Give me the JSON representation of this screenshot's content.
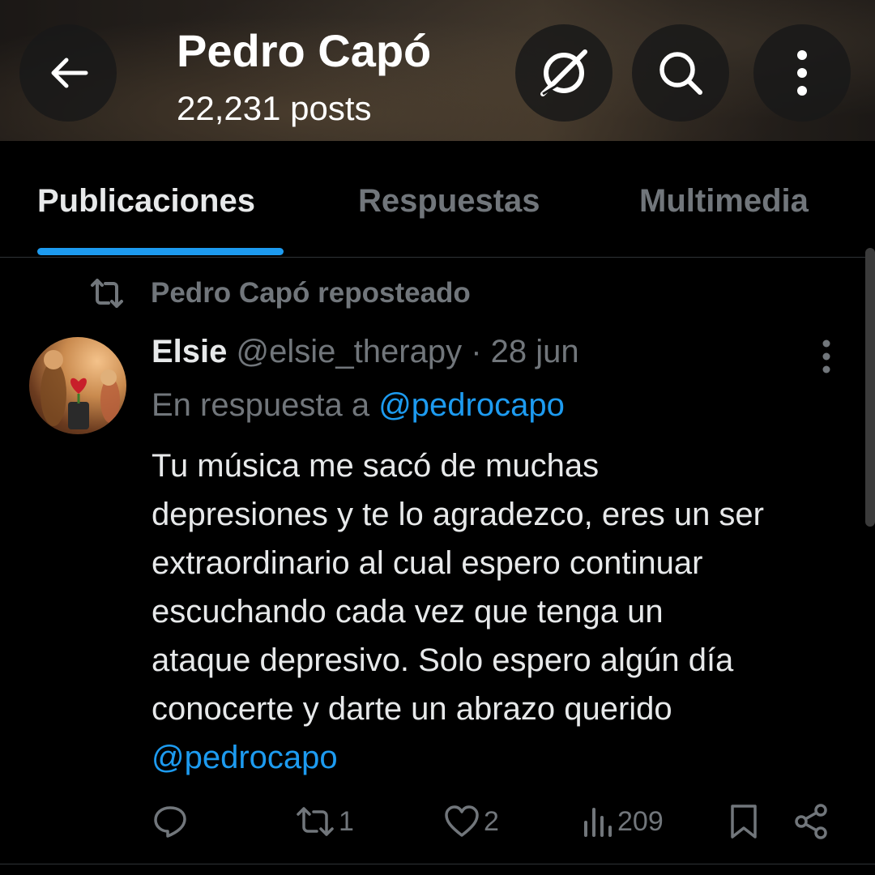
{
  "header": {
    "name": "Pedro Capó",
    "posts": "22,231 posts",
    "back_icon": "arrow-left-icon",
    "grok_icon": "grok-icon",
    "search_icon": "search-icon",
    "more_icon": "more-vertical-icon"
  },
  "tabs": [
    {
      "label": "Publicaciones",
      "active": true
    },
    {
      "label": "Respuestas",
      "active": false
    },
    {
      "label": "Multimedia",
      "active": false
    }
  ],
  "post": {
    "repost_label": "Pedro Capó reposteado",
    "author_name": "Elsie",
    "author_handle": "@elsie_therapy",
    "separator": " · ",
    "date": "28 jun",
    "reply_prefix": "En respuesta a ",
    "reply_mention": "@pedrocapo",
    "body_lines": [
      "Tu música me sacó de muchas",
      "depresiones y te lo agradezco, eres un ser",
      "extraordinario al cual espero continuar",
      "escuchando cada vez que tenga un",
      "ataque depresivo. Solo espero algún día",
      "conocerte y darte un abrazo querido"
    ],
    "body_mention": "@pedrocapo"
  },
  "actions": {
    "reply_count": "",
    "repost_count": "1",
    "like_count": "2",
    "views_count": "209"
  },
  "colors": {
    "accent": "#1d9bf0",
    "muted": "#71767b",
    "text": "#e7e9ea",
    "background": "#000000"
  }
}
